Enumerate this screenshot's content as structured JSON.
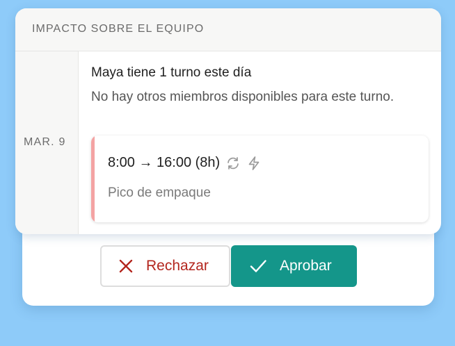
{
  "impact": {
    "title": "IMPACTO SOBRE EL EQUIPO",
    "date": "MAR. 9",
    "summary_title": "Maya tiene 1 turno este día",
    "summary_text": "No hay otros miembros disponibles para este turno."
  },
  "shift": {
    "time": "8:00 → 16:00 (8h)",
    "description": "Pico de empaque",
    "accent_color": "#f4a3a3",
    "icons": [
      "repeat-icon",
      "lightning-icon"
    ]
  },
  "actions": {
    "reject_label": "Rechazar",
    "approve_label": "Aprobar",
    "reject_color": "#b3261e",
    "approve_color": "#14968a"
  },
  "background_color": "#8ecbf9"
}
